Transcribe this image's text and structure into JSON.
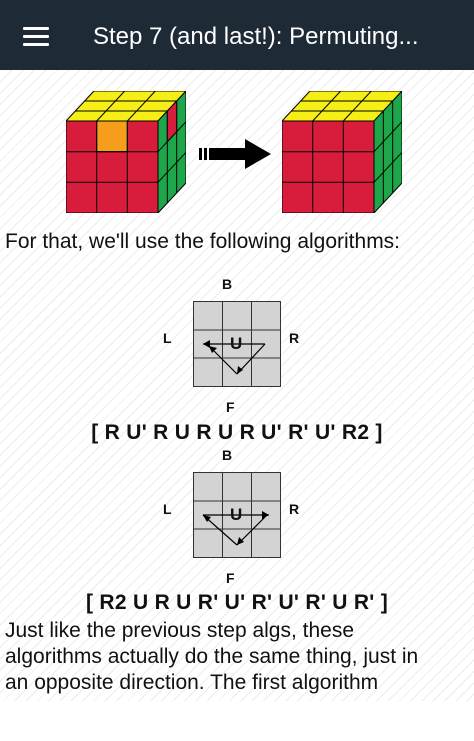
{
  "app_bar": {
    "title": "Step 7 (and last!): Permuting...",
    "menu_icon": "hamburger-menu-icon"
  },
  "colors": {
    "app_bar_bg": "#1e2a35",
    "cube_red": "#d81d3c",
    "cube_yellow": "#f6ee17",
    "cube_green": "#1ea64a",
    "cube_orange": "#f79d1c"
  },
  "intro_text": "For that, we'll use the following algorithms:",
  "diagrams": [
    {
      "top": "B",
      "left": "L",
      "right": "R",
      "bottom": "F",
      "center": "U"
    },
    {
      "top": "B",
      "left": "L",
      "right": "R",
      "bottom": "F",
      "center": "U"
    }
  ],
  "algorithms": [
    "[ R U' R U R U R U' R' U' R2 ]",
    "[ R2 U R U R' U' R' U' R' U R' ]"
  ],
  "body_text": [
    "Just like the previous step algs, these",
    "algorithms actually do the same thing, just in",
    "an opposite direction. The first algorithm"
  ]
}
